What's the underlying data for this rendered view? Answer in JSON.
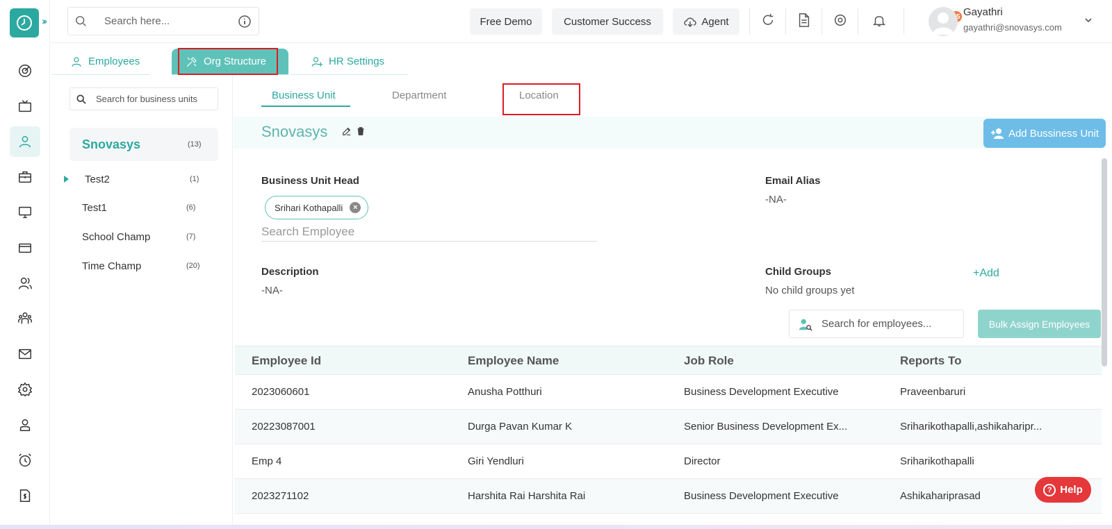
{
  "header": {
    "search_placeholder": "Search here...",
    "buttons": {
      "free_demo": "Free Demo",
      "customer_success": "Customer Success",
      "agent": "Agent"
    },
    "notification_count": "35",
    "user": {
      "name": "Gayathri",
      "email": "gayathri@snovasys.com"
    }
  },
  "rail": {
    "items": [
      "dashboard-icon",
      "tv-icon",
      "user-icon",
      "briefcase-icon",
      "monitor-icon",
      "card-icon",
      "users-icon",
      "team-icon",
      "mail-icon",
      "settings-icon",
      "badge-icon",
      "alarm-icon",
      "invoice-icon"
    ],
    "active_index": 2
  },
  "tabs": {
    "employees": "Employees",
    "org_structure": "Org Structure",
    "hr_settings": "HR Settings"
  },
  "left_panel": {
    "search_placeholder": "Search for business units",
    "units": [
      {
        "name": "Snovasys",
        "count": "(13)"
      },
      {
        "name": "Test2",
        "count": "(1)"
      },
      {
        "name": "Test1",
        "count": "(6)"
      },
      {
        "name": "School Champ",
        "count": "(7)"
      },
      {
        "name": "Time Champ",
        "count": "(20)"
      }
    ]
  },
  "sub_tabs": {
    "business_unit": "Business Unit",
    "department": "Department",
    "location": "Location"
  },
  "detail": {
    "title": "Snovasys",
    "add_button": "Add Bussiness Unit",
    "head_label": "Business Unit Head",
    "head_chip": "Srihari Kothapalli",
    "employee_search_placeholder": "Search Employee",
    "email_alias_label": "Email Alias",
    "email_alias_value": "-NA-",
    "description_label": "Description",
    "description_value": "-NA-",
    "child_groups_label": "Child Groups",
    "child_groups_value": "No child groups yet",
    "add_link": "+Add",
    "emp_search_placeholder": "Search for employees...",
    "bulk_button": "Bulk Assign Employees"
  },
  "table": {
    "columns": [
      "Employee Id",
      "Employee Name",
      "Job Role",
      "Reports To"
    ],
    "rows": [
      [
        "2023060601",
        "Anusha Potthuri",
        "Business Development Executive",
        "Praveenbaruri"
      ],
      [
        "20223087001",
        "Durga Pavan Kumar K",
        "Senior Business Development Ex...",
        "Sriharikothapalli,ashikaharipr..."
      ],
      [
        "Emp 4",
        "Giri Yendluri",
        "Director",
        "Sriharikothapalli"
      ],
      [
        "2023271102",
        "Harshita Rai Harshita Rai",
        "Business Development Executive",
        "Ashikahariprasad"
      ]
    ]
  },
  "help_button": "Help",
  "colors": {
    "accent": "#2ba9a0",
    "highlight": "#e01b22",
    "help": "#e5383b",
    "add_button": "#6ebde8"
  }
}
